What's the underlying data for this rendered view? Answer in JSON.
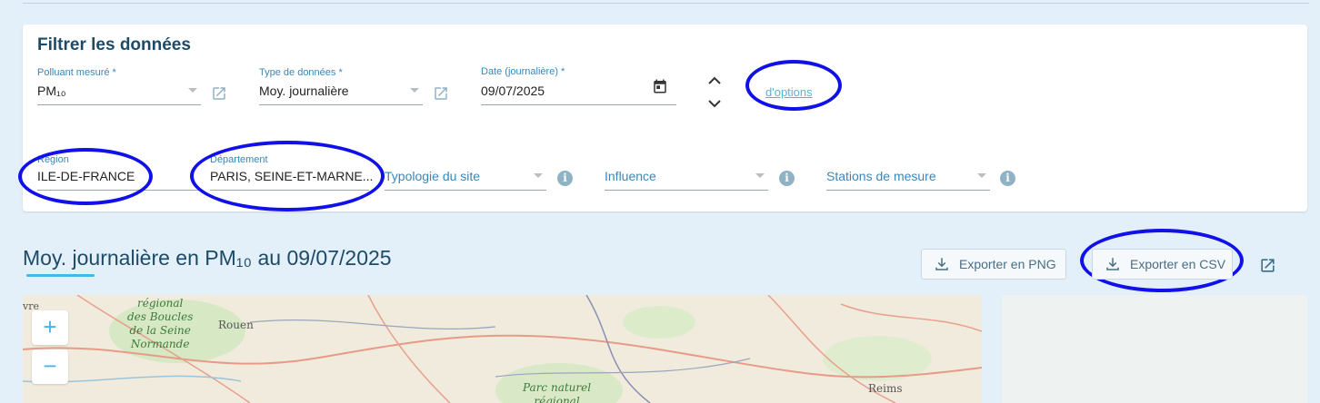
{
  "filter": {
    "title": "Filtrer les données",
    "polluant": {
      "label": "Polluant mesuré *",
      "value": "PM₁₀"
    },
    "type_donnees": {
      "label": "Type de données *",
      "value": "Moy. journalière"
    },
    "date": {
      "label": "Date (journalière) *",
      "value": "09/07/2025"
    },
    "options_link": "d'options",
    "region": {
      "label": "Région",
      "value": "ILE-DE-FRANCE"
    },
    "departement": {
      "label": "Département",
      "value": "PARIS, SEINE-ET-MARNE..."
    },
    "typologie": {
      "placeholder": "Typologie du site"
    },
    "influence": {
      "placeholder": "Influence"
    },
    "stations": {
      "placeholder": "Stations de mesure"
    },
    "info_glyph": "i"
  },
  "heading": {
    "title": "Moy. journalière en PM₁₀ au 09/07/2025"
  },
  "export": {
    "png_label": "Exporter en PNG",
    "csv_label": "Exporter en CSV"
  },
  "map": {
    "zoom_in": "+",
    "zoom_out": "−",
    "labels": {
      "regional_line1": "régional",
      "regional_line2": "des Boucles",
      "regional_line3": "de la Seine",
      "regional_line4": "Normande",
      "rouen": "Rouen",
      "parc_line1": "Parc naturel",
      "parc_line2": "régional",
      "reims": "Reims",
      "edge": "vre"
    }
  },
  "colors": {
    "accent": "#45b7e6",
    "heading": "#1d4a66",
    "scribble": "#1010e8"
  },
  "icons": [
    "open-in-new-icon",
    "calendar-icon",
    "chevron-up-icon",
    "chevron-down-icon",
    "info-icon",
    "download-icon"
  ]
}
